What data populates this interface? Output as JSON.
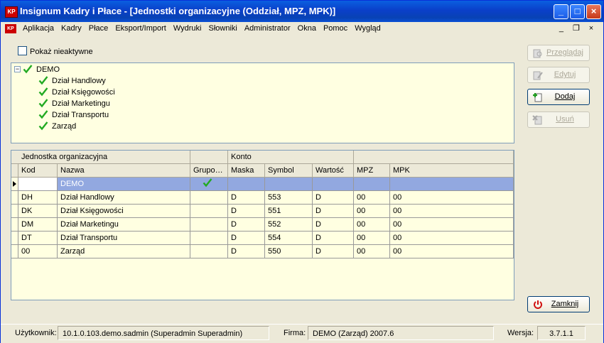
{
  "window": {
    "title": "Insignum Kadry i Płace - [Jednostki organizacyjne (Oddział, MPZ, MPK)]",
    "app_icon_text": "KP",
    "minimize": "_",
    "maximize": "□",
    "close": "×"
  },
  "menubar": {
    "items": [
      "Aplikacja",
      "Kadry",
      "Płace",
      "Eksport/Import",
      "Wydruki",
      "Słowniki",
      "Administrator",
      "Okna",
      "Pomoc",
      "Wygląd"
    ],
    "mdi_min": "_",
    "mdi_restore": "❐",
    "mdi_close": "×"
  },
  "filter": {
    "show_inactive_label": "Pokaż nieaktywne"
  },
  "tree": {
    "root": "DEMO",
    "expander": "−",
    "children": [
      "Dział Handlowy",
      "Dział Księgowości",
      "Dział Marketingu",
      "Dział Transportu",
      "Zarząd"
    ]
  },
  "grid": {
    "bands": [
      "Jednostka organizacyjna",
      "",
      "Konto",
      ""
    ],
    "headers": [
      "Kod",
      "Nazwa",
      "Grupo…",
      "Maska",
      "Symbol",
      "Wartość",
      "MPZ",
      "MPK"
    ],
    "rows": [
      {
        "kod": "",
        "nazwa": "DEMO",
        "grupowa": true,
        "maska": "",
        "symbol": "",
        "wartosc": "",
        "mpz": "",
        "mpk": ""
      },
      {
        "kod": "DH",
        "nazwa": "Dział Handlowy",
        "grupowa": false,
        "maska": "D",
        "symbol": "553",
        "wartosc": "D",
        "mpz": "00",
        "mpk": "00"
      },
      {
        "kod": "DK",
        "nazwa": "Dział Księgowości",
        "grupowa": false,
        "maska": "D",
        "symbol": "551",
        "wartosc": "D",
        "mpz": "00",
        "mpk": "00"
      },
      {
        "kod": "DM",
        "nazwa": "Dział Marketingu",
        "grupowa": false,
        "maska": "D",
        "symbol": "552",
        "wartosc": "D",
        "mpz": "00",
        "mpk": "00"
      },
      {
        "kod": "DT",
        "nazwa": "Dział Transportu",
        "grupowa": false,
        "maska": "D",
        "symbol": "554",
        "wartosc": "D",
        "mpz": "00",
        "mpk": "00"
      },
      {
        "kod": "00",
        "nazwa": "Zarząd",
        "grupowa": false,
        "maska": "D",
        "symbol": "550",
        "wartosc": "D",
        "mpz": "00",
        "mpk": "00"
      }
    ]
  },
  "buttons": {
    "przegladaj": "Przeglądaj",
    "edytuj": "Edytuj",
    "dodaj": "Dodaj",
    "usun": "Usuń",
    "zamknij": "Zamknij"
  },
  "status": {
    "user_label": "Użytkownik:",
    "user_value": "10.1.0.103.demo.sadmin (Superadmin Superadmin)",
    "firm_label": "Firma:",
    "firm_value": "DEMO (Zarząd) 2007.6",
    "version_label": "Wersja:",
    "version_value": "3.7.1.1"
  },
  "colors": {
    "check_green": "#22aa22",
    "selected_row": "#92a8e0",
    "panel_bg": "#ffffe1"
  }
}
